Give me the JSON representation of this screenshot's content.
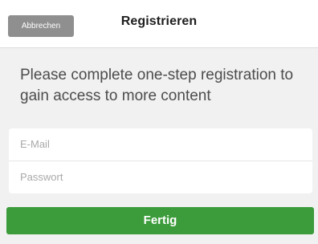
{
  "header": {
    "cancel_label": "Abbrechen",
    "title": "Registrieren"
  },
  "main": {
    "message": "Please complete one-step registration to gain access to more content"
  },
  "form": {
    "email_placeholder": "E-Mail",
    "password_placeholder": "Passwort",
    "submit_label": "Fertig"
  },
  "colors": {
    "accent": "#3c9c3c",
    "cancel_bg": "#8f8f8f"
  }
}
